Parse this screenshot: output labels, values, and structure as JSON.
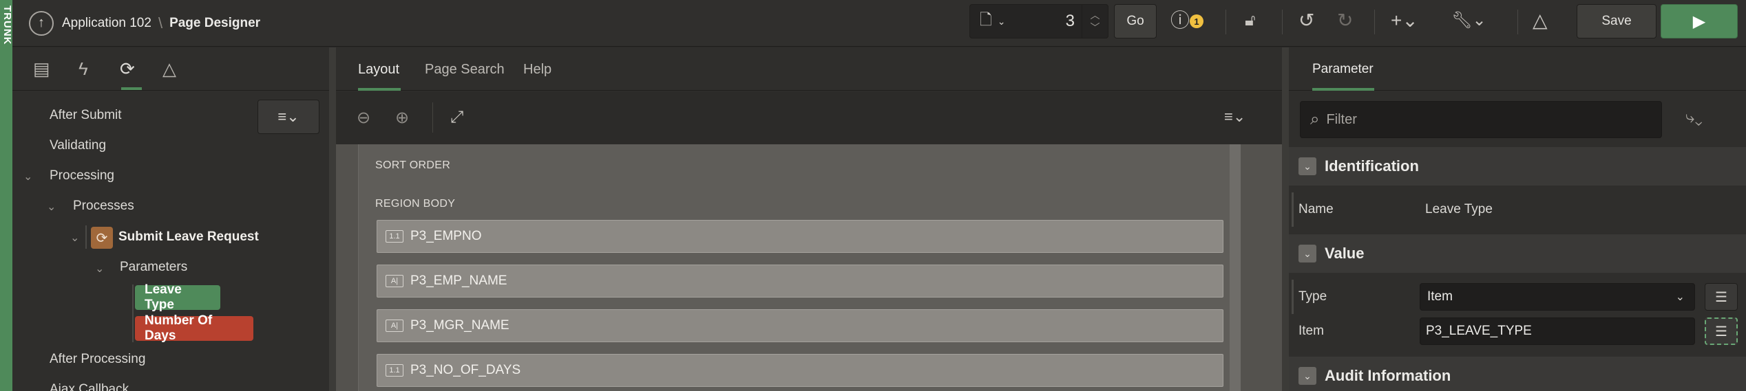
{
  "app": {
    "title": "Application 102",
    "separator": "\\",
    "section": "Page Designer",
    "side_label": "TRUNK"
  },
  "toolbar": {
    "page_number": "3",
    "go_label": "Go",
    "warning_count": "1",
    "save_label": "Save",
    "icons": [
      "page-icon",
      "warning-icon",
      "lock-icon",
      "undo-icon",
      "redo-icon",
      "create-icon",
      "utilities-icon",
      "shared-components-icon",
      "run-icon"
    ]
  },
  "left_panel": {
    "tabs": [
      "rendering-icon",
      "dynamic-actions-icon",
      "processing-icon",
      "shared-components-icon"
    ],
    "tree": {
      "after_submit": "After Submit",
      "validating": "Validating",
      "processing": "Processing",
      "processes": "Processes",
      "submit_leave_request": "Submit Leave Request",
      "parameters": "Parameters",
      "leave_type": "Leave Type",
      "number_of_days": "Number Of Days",
      "after_processing": "After Processing",
      "ajax_callback": "Ajax Callback"
    }
  },
  "center_panel": {
    "tabs": [
      "Layout",
      "Page Search",
      "Help"
    ],
    "sort_order_label": "SORT ORDER",
    "region_body_label": "REGION BODY",
    "items": [
      {
        "icon": "1.1",
        "name": "P3_EMPNO"
      },
      {
        "icon": "A|",
        "name": "P3_EMP_NAME"
      },
      {
        "icon": "A|",
        "name": "P3_MGR_NAME"
      },
      {
        "icon": "1.1",
        "name": "P3_NO_OF_DAYS"
      }
    ]
  },
  "right_panel": {
    "tab": "Parameter",
    "filter_placeholder": "Filter",
    "sections": {
      "identification": "Identification",
      "value": "Value",
      "audit": "Audit Information"
    },
    "props": {
      "name_label": "Name",
      "name_value": "Leave Type",
      "type_label": "Type",
      "type_value": "Item",
      "item_label": "Item",
      "item_value": "P3_LEAVE_TYPE"
    }
  },
  "colors": {
    "accent_green": "#4f8a5a",
    "error_red": "#b8412f",
    "warning_yellow": "#f0c040",
    "background": "#2b2a28"
  }
}
